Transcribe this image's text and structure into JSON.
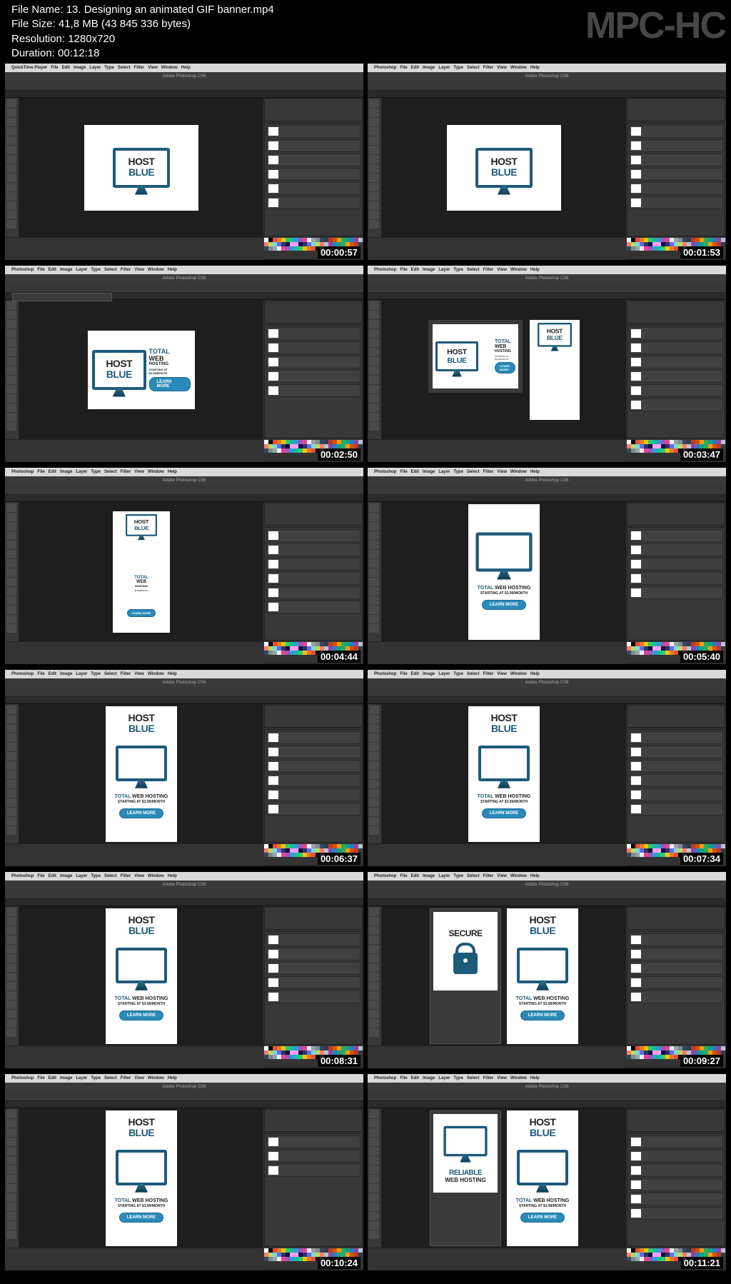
{
  "watermark": "MPC-HC",
  "header": {
    "l1_label": "File Name:",
    "l1_val": "13. Designing an animated GIF banner.mp4",
    "l2_label": "File Size:",
    "l2_val": "41,8 MB (43 845 336 bytes)",
    "l3_label": "Resolution:",
    "l3_val": "1280x720",
    "l4_label": "Duration:",
    "l4_val": "00:12:18"
  },
  "menu": {
    "apple": "",
    "app1": "QuickTime Player",
    "app2": "Photoshop",
    "items": [
      "File",
      "Edit",
      "Image",
      "Layer",
      "Type",
      "Select",
      "Filter",
      "View",
      "Window",
      "Help"
    ]
  },
  "app_title": "Adobe Photoshop CS6",
  "brand": {
    "host": "HOST",
    "blue": "BLUE",
    "total": "TOTAL",
    "web": "WEB",
    "hosting": "HOSTING",
    "total_web_hosting": "TOTAL WEB HOSTING",
    "starting": "STARTING AT",
    "price": "$3.99/MONTH",
    "starting_full": "STARTING AT $3.99/MONTH",
    "learn": "LEARN MORE",
    "secure": "SECURE",
    "reliable": "RELIABLE",
    "web_hosting": "WEB HOSTING"
  },
  "timestamps": [
    "00:00:57",
    "00:01:53",
    "00:02:50",
    "00:03:47",
    "00:04:44",
    "00:05:40",
    "00:06:37",
    "00:07:34",
    "00:08:31",
    "00:09:27",
    "00:10:24",
    "00:11:21"
  ],
  "swatch_colors": [
    "#fff",
    "#000",
    "#e74c3c",
    "#e67e22",
    "#f1c40f",
    "#2ecc71",
    "#1abc9c",
    "#3498db",
    "#9b59b6",
    "#e84393",
    "#ecf0f1",
    "#95a5a6",
    "#7f8c8d",
    "#34495e",
    "#2c3e50",
    "#c0392b",
    "#d35400",
    "#f39c12",
    "#27ae60",
    "#16a085",
    "#2980b9",
    "#8e44ad",
    "#bdc3c7",
    "#ff7979",
    "#badc58",
    "#7ed6df",
    "#686de0",
    "#30336b",
    "#130f40",
    "#ff9ff3"
  ]
}
